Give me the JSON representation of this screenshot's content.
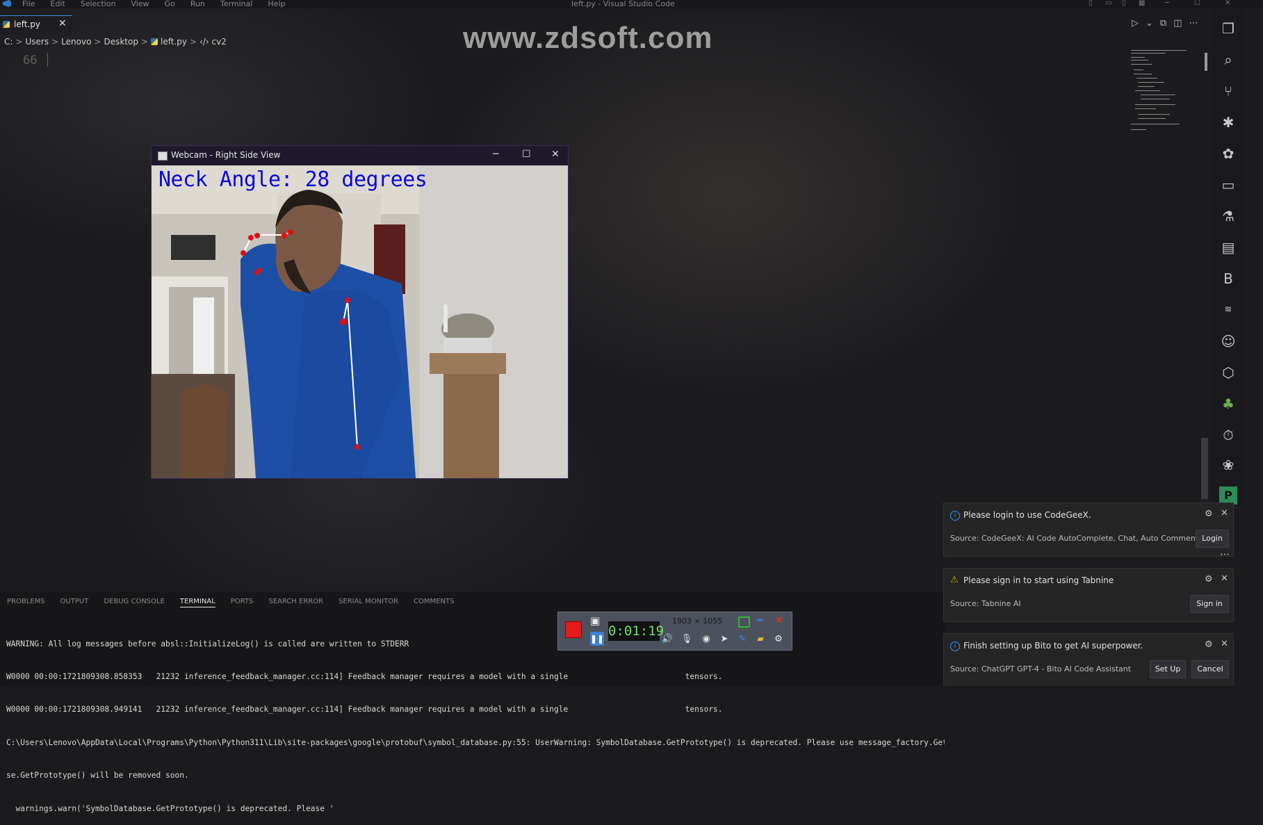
{
  "window": {
    "title": "left.py - Visual Studio Code",
    "menu": [
      "File",
      "Edit",
      "Selection",
      "View",
      "Go",
      "Run",
      "Terminal",
      "Help"
    ]
  },
  "tab": {
    "label": "left.py",
    "close_glyph": "✕"
  },
  "breadcrumb": {
    "items": [
      "C:",
      "Users",
      "Lenovo",
      "Desktop",
      "left.py"
    ],
    "symbol": "cv2",
    "sep": ">"
  },
  "editor": {
    "line_number": "66"
  },
  "watermark": "www.zdsoft.com",
  "webcam": {
    "title": "Webcam - Right Side View",
    "overlay_text": "Neck Angle: 28 degrees",
    "min_glyph": "─",
    "max_glyph": "☐",
    "close_glyph": "✕"
  },
  "panel": {
    "tabs": [
      "PROBLEMS",
      "OUTPUT",
      "DEBUG CONSOLE",
      "TERMINAL",
      "PORTS",
      "SEARCH ERROR",
      "SERIAL MONITOR",
      "COMMENTS"
    ],
    "active_tab": "TERMINAL",
    "terminal_lines": [
      "WARNING: All log messages before absl::InitializeLog() is called are written to STDERR",
      "W0000 00:00:1721809308.858353   21232 inference_feedback_manager.cc:114] Feedback manager requires a model with a single                         tensors.",
      "W0000 00:00:1721809308.949141   21232 inference_feedback_manager.cc:114] Feedback manager requires a model with a single                         tensors.",
      "C:\\Users\\Lenovo\\AppData\\Local\\Programs\\Python\\Python311\\Lib\\site-packages\\google\\protobuf\\symbol_database.py:55: UserWarning: SymbolDatabase.GetPrototype() is deprecated. Please use message_factory.GetMessa",
      "se.GetPrototype() will be removed soon.",
      "  warnings.warn('SymbolDatabase.GetPrototype() is deprecated. Please '"
    ]
  },
  "recorder": {
    "timer": "0:01:19",
    "resolution": "1903 × 1055"
  },
  "notifications": [
    {
      "icon": "info",
      "message": "Please login to use CodeGeeX.",
      "source": "Source: CodeGeeX: AI Code AutoComplete, Chat, Auto Comment",
      "buttons": [
        "Login"
      ]
    },
    {
      "icon": "warning",
      "message": "Please sign in to start using Tabnine",
      "source": "Source: Tabnine AI",
      "buttons": [
        "Sign in"
      ]
    },
    {
      "icon": "info",
      "message": "Finish setting up Bito to get AI superpower.",
      "source": "Source: ChatGPT GPT-4 - Bito AI Code Assistant",
      "buttons": [
        "Set Up",
        "Cancel"
      ]
    }
  ],
  "activity_icons": [
    "explorer-icon",
    "search-icon",
    "source-control-icon",
    "debug-icon",
    "extensions-icon",
    "remote-explorer-icon",
    "testing-icon",
    "notebook-icon",
    "bito-icon",
    "codegpt-icon",
    "copilot-icon",
    "hexagon-icon",
    "python-icon",
    "timeline-icon",
    "paw-icon",
    "p-extension-icon"
  ],
  "activity_glyphs": [
    "❐",
    "⌕",
    "⑂",
    "✱",
    "✿",
    "▭",
    "⚗",
    "▤",
    "B",
    "≋",
    "☺",
    "⬡",
    "♣",
    "⏱",
    "❀",
    "P"
  ],
  "colors": {
    "accent": "#3794ff",
    "overlay_text": "#0a0ad8",
    "pose_points": "#e01010",
    "record_button": "#e21b1b"
  }
}
